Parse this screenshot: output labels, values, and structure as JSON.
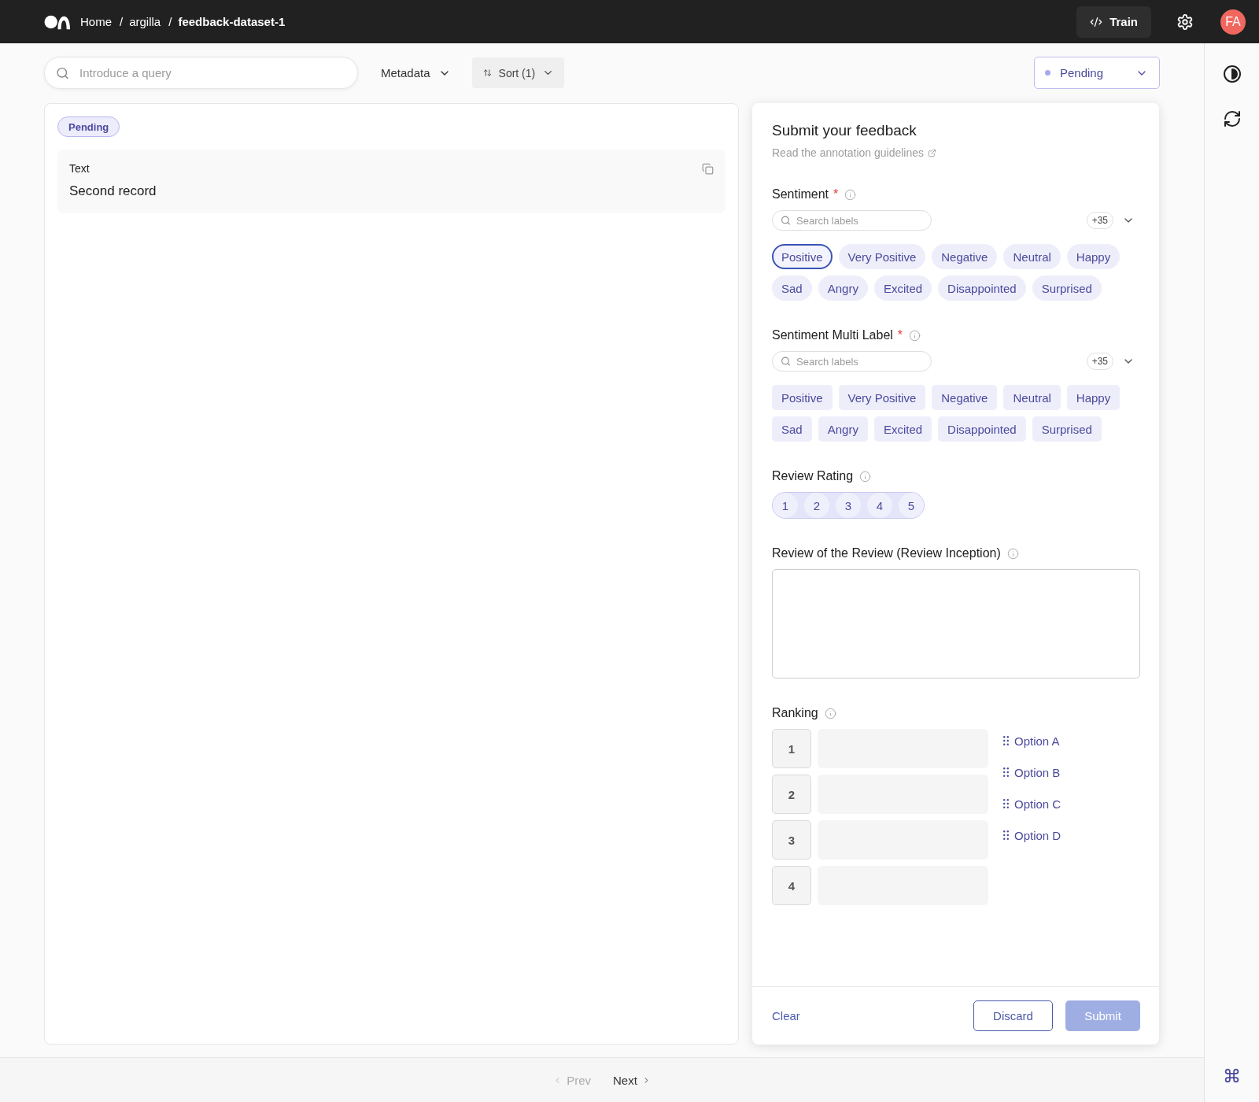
{
  "top_bar": {
    "breadcrumbs": [
      {
        "label": "Home",
        "current": false
      },
      {
        "separator": "/",
        "label": "argilla",
        "current": false
      },
      {
        "separator": "/",
        "label": "feedback-dataset-1",
        "current": true
      }
    ],
    "train_button": "Train",
    "avatar": "FA"
  },
  "toolbar": {
    "search": {
      "placeholder": "Introduce a query"
    },
    "metadata": "Metadata",
    "sort": "Sort (1)",
    "status_filter": "Pending"
  },
  "record": {
    "status": "Pending",
    "fields": [
      {
        "title": "Text",
        "content": "Second record"
      }
    ]
  },
  "form": {
    "title": "Submit your feedback",
    "guidelines_link": "Read the annotation guidelines",
    "questions": [
      {
        "kind": "single",
        "title": "Sentiment",
        "required_mark": "*",
        "search": {
          "placeholder": "Search labels"
        },
        "more_count": "+35",
        "options": [
          {
            "label": "Positive",
            "selected": true
          },
          {
            "label": "Very Positive",
            "selected": false
          },
          {
            "label": "Negative",
            "selected": false
          },
          {
            "label": "Neutral",
            "selected": false
          },
          {
            "label": "Happy",
            "selected": false
          },
          {
            "label": "Sad",
            "selected": false
          },
          {
            "label": "Angry",
            "selected": false
          },
          {
            "label": "Excited",
            "selected": false
          },
          {
            "label": "Disappointed",
            "selected": false
          },
          {
            "label": "Surprised",
            "selected": false
          }
        ]
      },
      {
        "kind": "multi",
        "title": "Sentiment Multi Label",
        "required_mark": "*",
        "search": {
          "placeholder": "Search labels"
        },
        "more_count": "+35",
        "options": [
          {
            "label": "Positive",
            "selected": false
          },
          {
            "label": "Very Positive",
            "selected": false
          },
          {
            "label": "Negative",
            "selected": false
          },
          {
            "label": "Neutral",
            "selected": false
          },
          {
            "label": "Happy",
            "selected": false
          },
          {
            "label": "Sad",
            "selected": false
          },
          {
            "label": "Angry",
            "selected": false
          },
          {
            "label": "Excited",
            "selected": false
          },
          {
            "label": "Disappointed",
            "selected": false
          },
          {
            "label": "Surprised",
            "selected": false
          }
        ]
      },
      {
        "kind": "rating",
        "title": "Review Rating",
        "options": [
          {
            "label": "1",
            "selected": false
          },
          {
            "label": "2",
            "selected": false
          },
          {
            "label": "3",
            "selected": false
          },
          {
            "label": "4",
            "selected": false
          },
          {
            "label": "5",
            "selected": false
          }
        ]
      },
      {
        "kind": "text",
        "title": "Review of the Review (Review Inception)"
      },
      {
        "kind": "ranking",
        "title": "Ranking",
        "slots": [
          "1",
          "2",
          "3",
          "4"
        ],
        "options": [
          "Option A",
          "Option B",
          "Option C",
          "Option D"
        ]
      }
    ]
  },
  "footer": {
    "clear": "Clear",
    "discard": "Discard",
    "submit": {
      "label": "Submit",
      "disabled": true
    }
  },
  "pagination": {
    "prev": {
      "label": "Prev",
      "disabled": true
    },
    "next": {
      "label": "Next",
      "disabled": false
    }
  }
}
